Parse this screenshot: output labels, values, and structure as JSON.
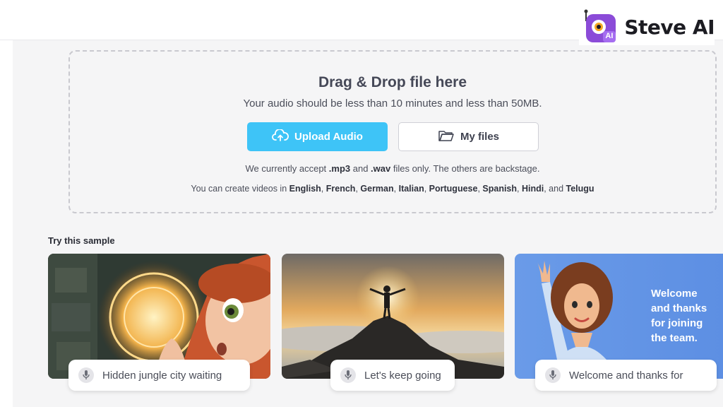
{
  "brand": {
    "name": "Steve AI",
    "logo_badge": "AI",
    "logo_colors": {
      "primary": "#8b4bd8",
      "accent": "#f5a623"
    }
  },
  "upload": {
    "title": "Drag & Drop file here",
    "subtitle": "Your audio should be less than 10 minutes and less than 50MB.",
    "upload_button": "Upload Audio",
    "files_button": "My files",
    "accept": {
      "prefix": "We currently accept ",
      "mp3": ".mp3",
      "and": " and ",
      "wav": ".wav",
      "suffix": " files only. The others are backstage."
    },
    "languages": {
      "prefix": "You can create videos in ",
      "list": [
        "English",
        "French",
        "German",
        "Italian",
        "Portuguese",
        "Spanish",
        "Hindi"
      ],
      "and": "and",
      "last": "Telugu"
    }
  },
  "samples": {
    "title": "Try this sample",
    "items": [
      {
        "label": "Hidden jungle city waiting",
        "icon": "mic-icon"
      },
      {
        "label": "Let's keep going",
        "icon": "mic-icon"
      },
      {
        "label": "Welcome and thanks for",
        "icon": "mic-icon",
        "card_text": [
          "Welcome",
          "and thanks",
          "for joining",
          "the team."
        ]
      }
    ]
  },
  "colors": {
    "upload_button": "#3ec4f7",
    "page_bg": "#f5f5f6"
  }
}
